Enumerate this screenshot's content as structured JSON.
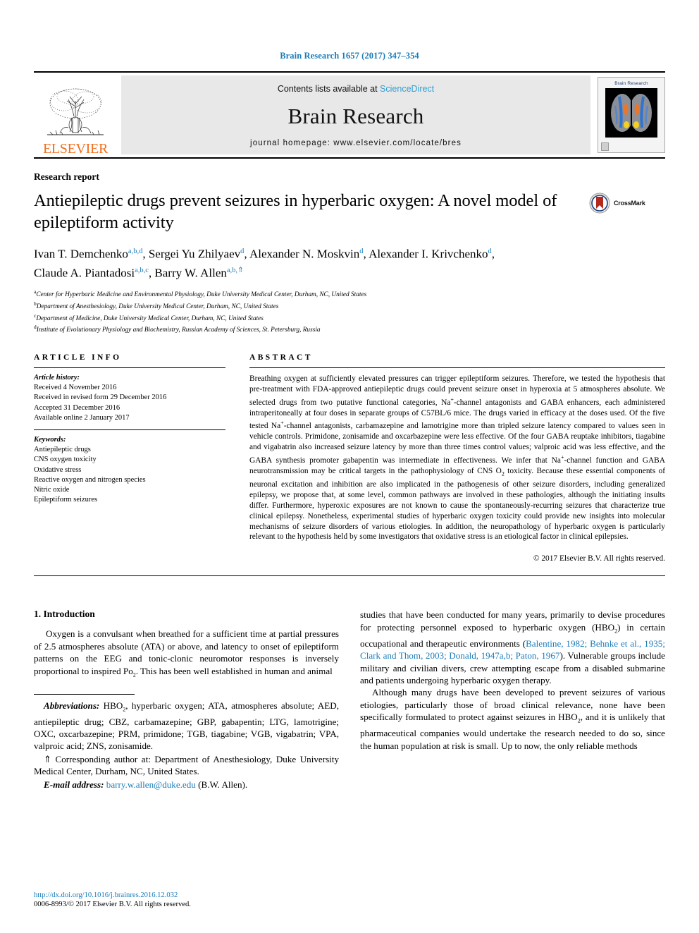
{
  "running_head": "Brain Research 1657 (2017) 347–354",
  "masthead": {
    "elsevier_wordmark": "ELSEVIER",
    "contents_prefix": "Contents lists available at ",
    "contents_link": "ScienceDirect",
    "journal_title": "Brain Research",
    "homepage": "journal homepage: www.elsevier.com/locate/bres",
    "cover_title": "Brain Research"
  },
  "article": {
    "kicker": "Research report",
    "title": "Antiepileptic drugs prevent seizures in hyperbaric oxygen: A novel model of epileptiform activity",
    "crossmark_label": "CrossMark",
    "authors_line1": "Ivan T. Demchenko",
    "authors": [
      {
        "name": "Ivan T. Demchenko",
        "sup": "a,b,d"
      },
      {
        "name": "Sergei Yu Zhilyaev",
        "sup": "d"
      },
      {
        "name": "Alexander N. Moskvin",
        "sup": "d"
      },
      {
        "name": "Alexander I. Krivchenko",
        "sup": "d"
      },
      {
        "name": "Claude A. Piantadosi",
        "sup": "a,b,c"
      },
      {
        "name": "Barry W. Allen",
        "sup": "a,b,"
      }
    ],
    "affiliations": [
      {
        "mark": "a",
        "text": "Center for Hyperbaric Medicine and Environmental Physiology, Duke University Medical Center, Durham, NC, United States"
      },
      {
        "mark": "b",
        "text": "Department of Anesthesiology, Duke University Medical Center, Durham, NC, United States"
      },
      {
        "mark": "c",
        "text": "Department of Medicine, Duke University Medical Center, Durham, NC, United States"
      },
      {
        "mark": "d",
        "text": "Institute of Evolutionary Physiology and Biochemistry, Russian Academy of Sciences, St. Petersburg, Russia"
      }
    ]
  },
  "article_info": {
    "heading": "ARTICLE INFO",
    "history_label": "Article history:",
    "history": [
      "Received 4 November 2016",
      "Received in revised form 29 December 2016",
      "Accepted 31 December 2016",
      "Available online 2 January 2017"
    ],
    "keywords_label": "Keywords:",
    "keywords": [
      "Antiepileptic drugs",
      "CNS oxygen toxicity",
      "Oxidative stress",
      "Reactive oxygen and nitrogen species",
      "Nitric oxide",
      "Epileptiform seizures"
    ]
  },
  "abstract": {
    "heading": "ABSTRACT",
    "text": "Breathing oxygen at sufficiently elevated pressures can trigger epileptiform seizures. Therefore, we tested the hypothesis that pre-treatment with FDA-approved antiepileptic drugs could prevent seizure onset in hyperoxia at 5 atmospheres absolute. We selected drugs from two putative functional categories, Na+-channel antagonists and GABA enhancers, each administered intraperitoneally at four doses in separate groups of C57BL/6 mice. The drugs varied in efficacy at the doses used. Of the five tested Na+-channel antagonists, carbamazepine and lamotrigine more than tripled seizure latency compared to values seen in vehicle controls. Primidone, zonisamide and oxcarbazepine were less effective. Of the four GABA reuptake inhibitors, tiagabine and vigabatrin also increased seizure latency by more than three times control values; valproic acid was less effective, and the GABA synthesis promoter gabapentin was intermediate in effectiveness. We infer that Na+-channel function and GABA neurotransmission may be critical targets in the pathophysiology of CNS O2 toxicity. Because these essential components of neuronal excitation and inhibition are also implicated in the pathogenesis of other seizure disorders, including generalized epilepsy, we propose that, at some level, common pathways are involved in these pathologies, although the initiating insults differ. Furthermore, hyperoxic exposures are not known to cause the spontaneously-recurring seizures that characterize true clinical epilepsy. Nonetheless, experimental studies of hyperbaric oxygen toxicity could provide new insights into molecular mechanisms of seizure disorders of various etiologies. In addition, the neuropathology of hyperbaric oxygen is particularly relevant to the hypothesis held by some investigators that oxidative stress is an etiological factor in clinical epilepsies.",
    "copyright": "© 2017 Elsevier B.V. All rights reserved."
  },
  "introduction": {
    "heading": "1. Introduction",
    "left_paragraph": "Oxygen is a convulsant when breathed for a sufficient time at partial pressures of 2.5 atmospheres absolute (ATA) or above, and latency to onset of epileptiform patterns on the EEG and tonic-clonic neuromotor responses is inversely proportional to inspired Po2. This has been well established in human and animal",
    "right_paragraph_1_a": "studies that have been conducted for many years, primarily to devise procedures for protecting personnel exposed to hyperbaric oxygen (HBO2) in certain occupational and therapeutic environments (",
    "right_paragraph_1_cite": "Balentine, 1982; Behnke et al., 1935; Clark and Thom, 2003; Donald, 1947a,b; Paton, 1967",
    "right_paragraph_1_b": "). Vulnerable groups include military and civilian divers, crew attempting escape from a disabled submarine and patients undergoing hyperbaric oxygen therapy.",
    "right_paragraph_2": "Although many drugs have been developed to prevent seizures of various etiologies, particularly those of broad clinical relevance, none have been specifically formulated to protect against seizures in HBO2, and it is unlikely that pharmaceutical companies would undertake the research needed to do so, since the human population at risk is small. Up to now, the only reliable methods"
  },
  "footnotes": {
    "abbreviations_label": "Abbreviations:",
    "abbreviations_text": " HBO2, hyperbaric oxygen; ATA, atmospheres absolute; AED, antiepileptic drug; CBZ, carbamazepine; GBP, gabapentin; LTG, lamotrigine; OXC, oxcarbazepine; PRM, primidone; TGB, tiagabine; VGB, vigabatrin; VPA, valproic acid; ZNS, zonisamide.",
    "corresponding": "⇑ Corresponding author at: Department of Anesthesiology, Duke University Medical Center, Durham, NC, United States.",
    "email_label": "E-mail address:",
    "email": "barry.w.allen@duke.edu",
    "email_suffix": " (B.W. Allen)."
  },
  "page_footer": {
    "doi": "http://dx.doi.org/10.1016/j.brainres.2016.12.032",
    "issn_line": "0006-8993/© 2017 Elsevier B.V. All rights reserved."
  },
  "colors": {
    "link_blue": "#1a7bb9",
    "sciencedirect_blue": "#2f9fd0",
    "elsevier_orange": "#F06F1E"
  }
}
